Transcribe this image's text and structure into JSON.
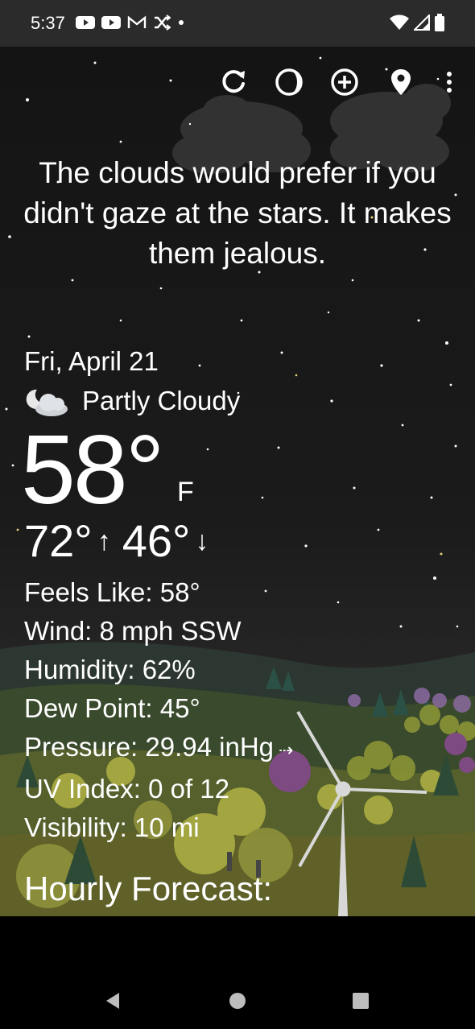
{
  "status_bar": {
    "time": "5:37",
    "left_icons": [
      "youtube-icon",
      "youtube-icon",
      "gmail-icon",
      "shuffle-icon",
      "dot-icon"
    ],
    "right_icons": [
      "wifi-icon",
      "cell-signal-icon",
      "battery-icon"
    ]
  },
  "toolbar": {
    "buttons": [
      "refresh-icon",
      "moon-phase-icon",
      "add-icon",
      "location-pin-icon",
      "more-vert-icon"
    ]
  },
  "quote": "The clouds would prefer if you didn't gaze at the stars. It makes them jealous.",
  "weather": {
    "date": "Fri, April 21",
    "condition_icon": "partly-cloudy-night-icon",
    "condition": "Partly Cloudy",
    "temperature": "58°",
    "unit": "F",
    "high": "72°",
    "high_arrow": "↑",
    "low": "46°",
    "low_arrow": "↓"
  },
  "details": {
    "feels_like": "Feels Like:  58°",
    "wind": "Wind:  8 mph SSW",
    "humidity": "Humidity:  62%",
    "dew_point": "Dew Point:  45°",
    "pressure": "Pressure:  29.94 inHg",
    "pressure_trend": "⇢",
    "uv_index": "UV Index:  0 of 12",
    "visibility": "Visibility:  10 mi"
  },
  "hourly_title": "Hourly Forecast:",
  "nav": [
    "back-icon",
    "home-icon",
    "recents-icon"
  ]
}
